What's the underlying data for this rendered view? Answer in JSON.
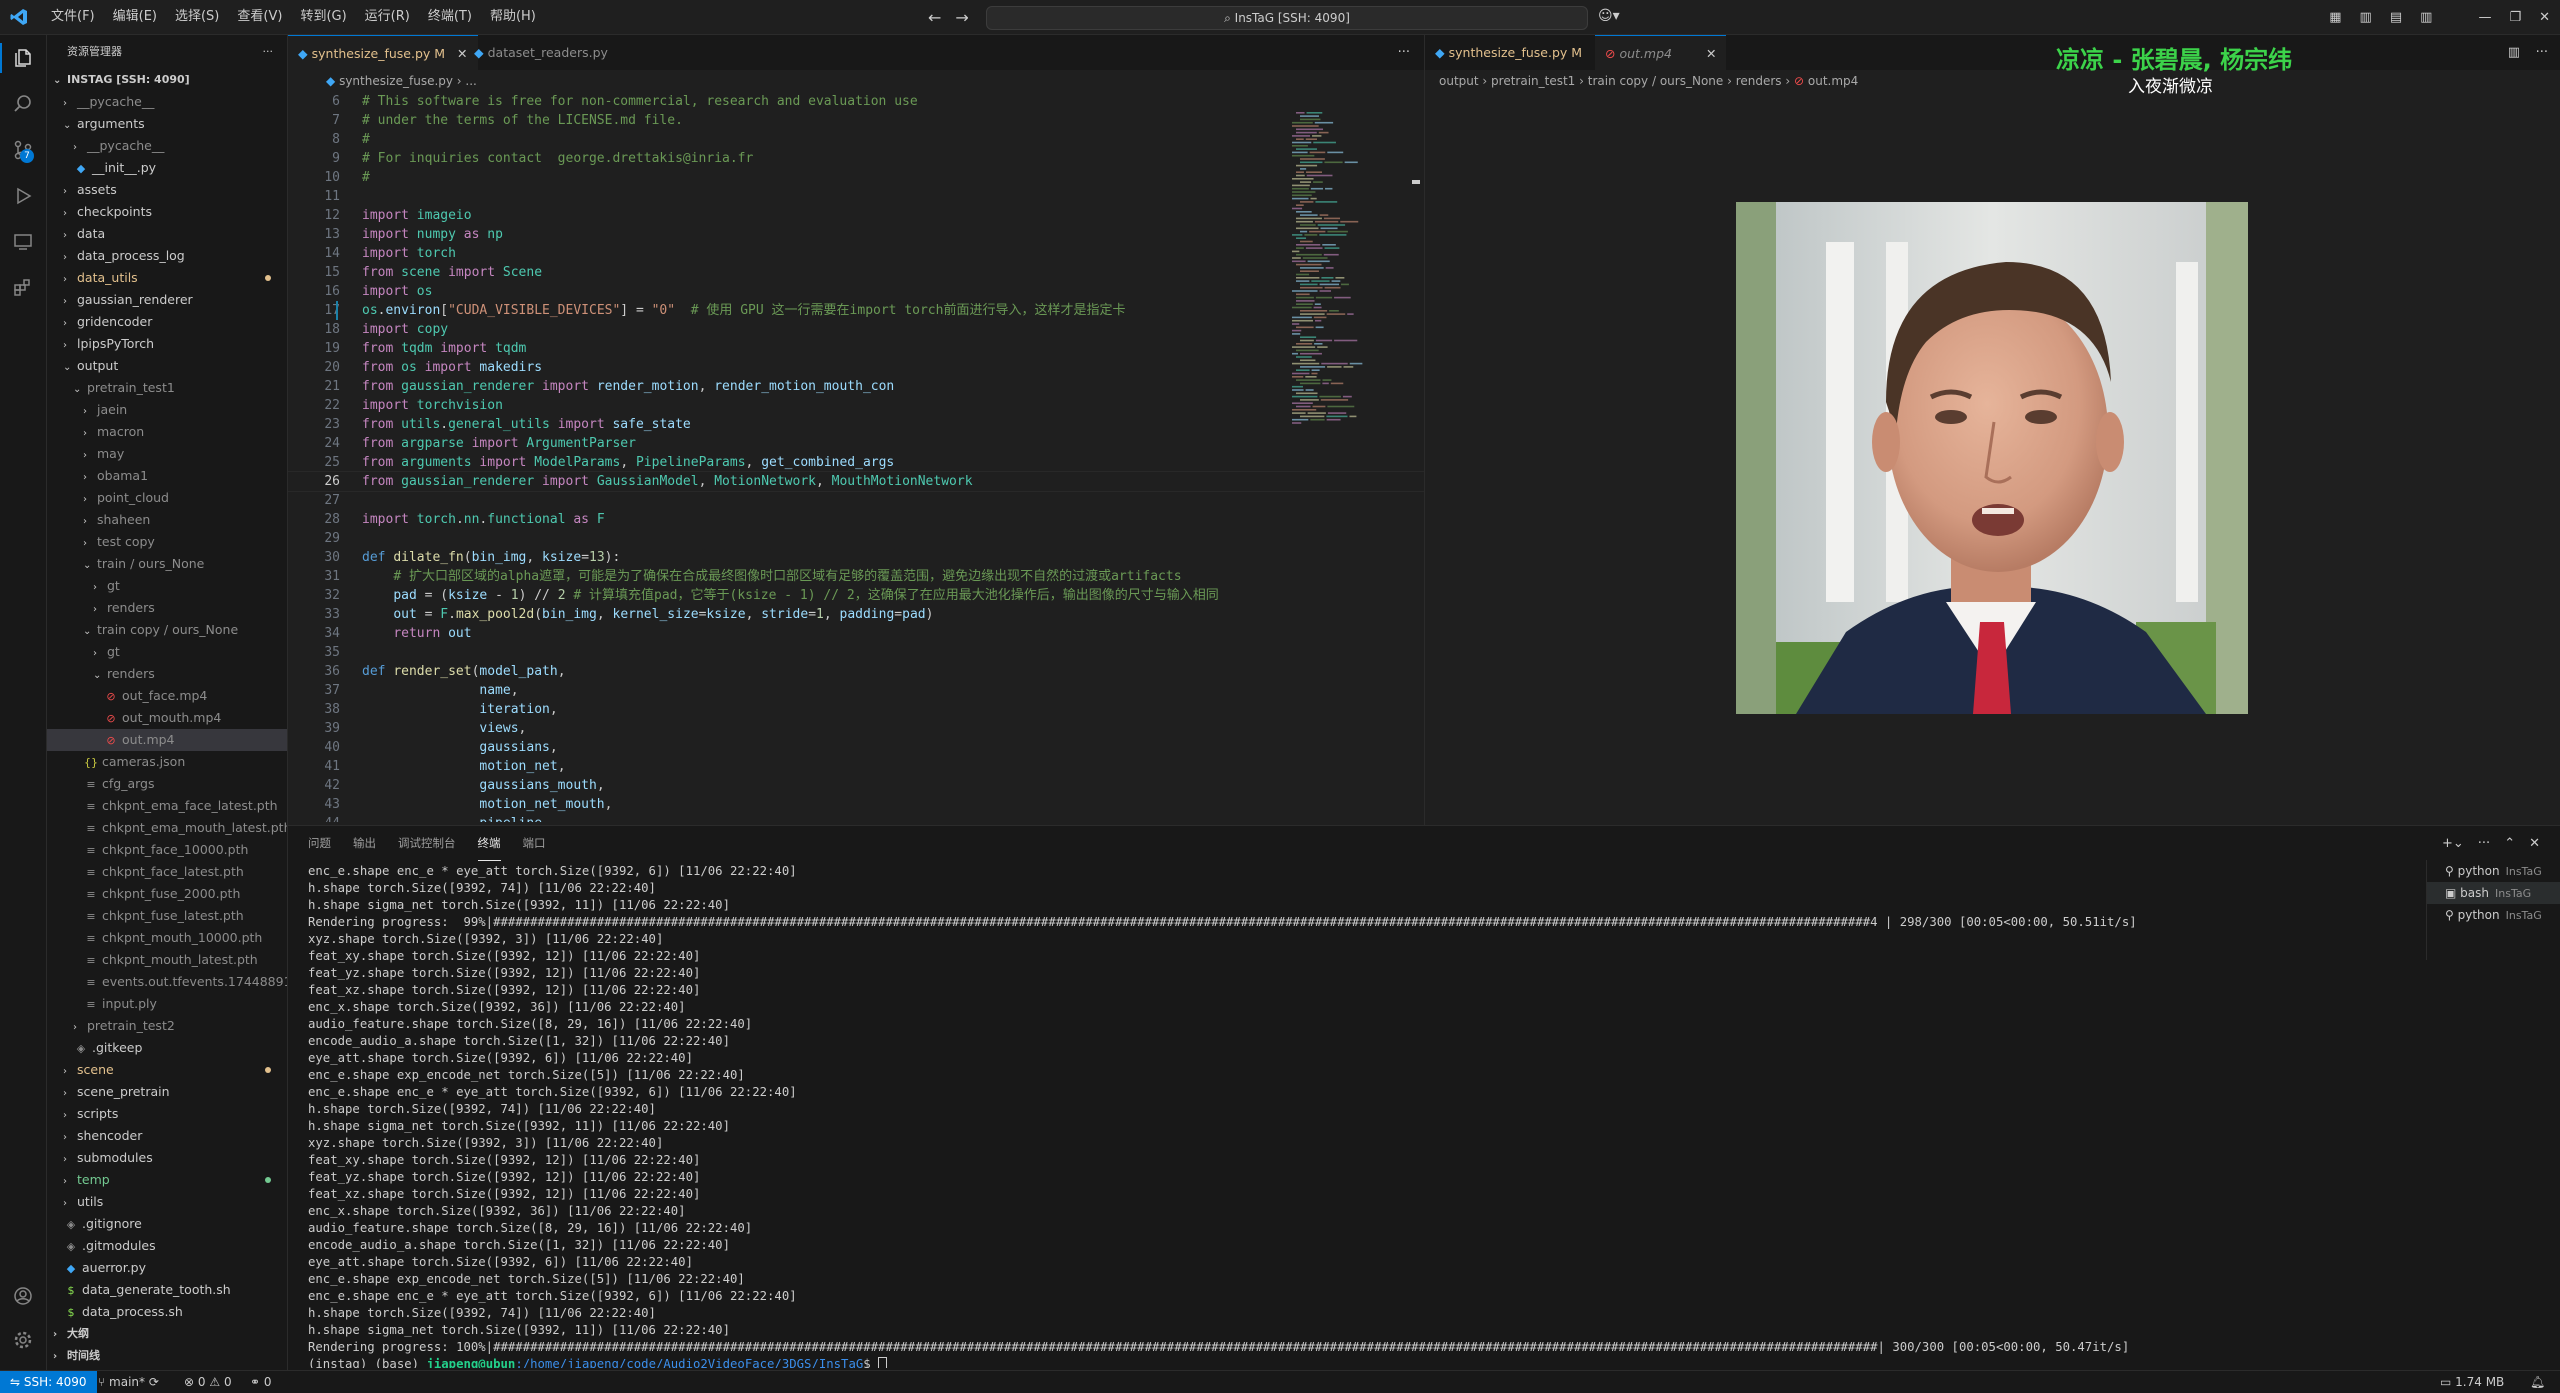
{
  "titlebar": {
    "menus": [
      "文件(F)",
      "编辑(E)",
      "选择(S)",
      "查看(V)",
      "转到(G)",
      "运行(R)",
      "终端(T)",
      "帮助(H)"
    ],
    "command_center": "InsTaG [SSH: 4090]"
  },
  "sidebar": {
    "header": "资源管理器",
    "root": "INSTAG [SSH: 4090]",
    "tree": [
      {
        "label": "__pycache__",
        "depth": 1,
        "kind": "folder",
        "color": "ignored"
      },
      {
        "label": "arguments",
        "depth": 1,
        "kind": "folder-open",
        "color": "default"
      },
      {
        "label": "__pycache__",
        "depth": 2,
        "kind": "folder",
        "color": "ignored"
      },
      {
        "label": "__init__.py",
        "depth": 2,
        "kind": "py",
        "color": "default"
      },
      {
        "label": "assets",
        "depth": 1,
        "kind": "folder",
        "color": "default"
      },
      {
        "label": "checkpoints",
        "depth": 1,
        "kind": "folder",
        "color": "default"
      },
      {
        "label": "data",
        "depth": 1,
        "kind": "folder",
        "color": "default"
      },
      {
        "label": "data_process_log",
        "depth": 1,
        "kind": "folder",
        "color": "default"
      },
      {
        "label": "data_utils",
        "depth": 1,
        "kind": "folder",
        "color": "mod",
        "dot": "#e2c08d"
      },
      {
        "label": "gaussian_renderer",
        "depth": 1,
        "kind": "folder",
        "color": "default"
      },
      {
        "label": "gridencoder",
        "depth": 1,
        "kind": "folder",
        "color": "default"
      },
      {
        "label": "lpipsPyTorch",
        "depth": 1,
        "kind": "folder",
        "color": "default"
      },
      {
        "label": "output",
        "depth": 1,
        "kind": "folder-open",
        "color": "default"
      },
      {
        "label": "pretrain_test1",
        "depth": 2,
        "kind": "folder-open",
        "color": "ignored"
      },
      {
        "label": "jaein",
        "depth": 3,
        "kind": "folder",
        "color": "ignored"
      },
      {
        "label": "macron",
        "depth": 3,
        "kind": "folder",
        "color": "ignored"
      },
      {
        "label": "may",
        "depth": 3,
        "kind": "folder",
        "color": "ignored"
      },
      {
        "label": "obama1",
        "depth": 3,
        "kind": "folder",
        "color": "ignored"
      },
      {
        "label": "point_cloud",
        "depth": 3,
        "kind": "folder",
        "color": "ignored"
      },
      {
        "label": "shaheen",
        "depth": 3,
        "kind": "folder",
        "color": "ignored"
      },
      {
        "label": "test copy",
        "depth": 3,
        "kind": "folder",
        "color": "ignored"
      },
      {
        "label": "train / ours_None",
        "depth": 3,
        "kind": "folder-open",
        "color": "ignored"
      },
      {
        "label": "gt",
        "depth": 4,
        "kind": "folder",
        "color": "ignored"
      },
      {
        "label": "renders",
        "depth": 4,
        "kind": "folder",
        "color": "ignored"
      },
      {
        "label": "train copy / ours_None",
        "depth": 3,
        "kind": "folder-open",
        "color": "ignored"
      },
      {
        "label": "gt",
        "depth": 4,
        "kind": "folder",
        "color": "ignored"
      },
      {
        "label": "renders",
        "depth": 4,
        "kind": "folder-open",
        "color": "ignored"
      },
      {
        "label": "out_face.mp4",
        "depth": 5,
        "kind": "mp4",
        "color": "ignored"
      },
      {
        "label": "out_mouth.mp4",
        "depth": 5,
        "kind": "mp4",
        "color": "ignored"
      },
      {
        "label": "out.mp4",
        "depth": 5,
        "kind": "mp4",
        "color": "ignored",
        "selected": true
      },
      {
        "label": "cameras.json",
        "depth": 3,
        "kind": "json",
        "color": "ignored"
      },
      {
        "label": "cfg_args",
        "depth": 3,
        "kind": "file",
        "color": "ignored"
      },
      {
        "label": "chkpnt_ema_face_latest.pth",
        "depth": 3,
        "kind": "file",
        "color": "ignored"
      },
      {
        "label": "chkpnt_ema_mouth_latest.pth",
        "depth": 3,
        "kind": "file",
        "color": "ignored"
      },
      {
        "label": "chkpnt_face_10000.pth",
        "depth": 3,
        "kind": "file",
        "color": "ignored"
      },
      {
        "label": "chkpnt_face_latest.pth",
        "depth": 3,
        "kind": "file",
        "color": "ignored"
      },
      {
        "label": "chkpnt_fuse_2000.pth",
        "depth": 3,
        "kind": "file",
        "color": "ignored"
      },
      {
        "label": "chkpnt_fuse_latest.pth",
        "depth": 3,
        "kind": "file",
        "color": "ignored"
      },
      {
        "label": "chkpnt_mouth_10000.pth",
        "depth": 3,
        "kind": "file",
        "color": "ignored"
      },
      {
        "label": "chkpnt_mouth_latest.pth",
        "depth": 3,
        "kind": "file",
        "color": "ignored"
      },
      {
        "label": "events.out.tfevents.174488912...",
        "depth": 3,
        "kind": "file",
        "color": "ignored"
      },
      {
        "label": "input.ply",
        "depth": 3,
        "kind": "file",
        "color": "ignored"
      },
      {
        "label": "pretrain_test2",
        "depth": 2,
        "kind": "folder",
        "color": "ignored"
      },
      {
        "label": ".gitkeep",
        "depth": 2,
        "kind": "git",
        "color": "default"
      },
      {
        "label": "scene",
        "depth": 1,
        "kind": "folder",
        "color": "mod",
        "dot": "#e2c08d"
      },
      {
        "label": "scene_pretrain",
        "depth": 1,
        "kind": "folder",
        "color": "default"
      },
      {
        "label": "scripts",
        "depth": 1,
        "kind": "folder",
        "color": "default"
      },
      {
        "label": "shencoder",
        "depth": 1,
        "kind": "folder",
        "color": "default"
      },
      {
        "label": "submodules",
        "depth": 1,
        "kind": "folder",
        "color": "default"
      },
      {
        "label": "temp",
        "depth": 1,
        "kind": "folder",
        "color": "untracked",
        "dot": "#73c991"
      },
      {
        "label": "utils",
        "depth": 1,
        "kind": "folder",
        "color": "default"
      },
      {
        "label": ".gitignore",
        "depth": 1,
        "kind": "git",
        "color": "default"
      },
      {
        "label": ".gitmodules",
        "depth": 1,
        "kind": "git",
        "color": "default"
      },
      {
        "label": "auerror.py",
        "depth": 1,
        "kind": "py",
        "color": "default"
      },
      {
        "label": "data_generate_tooth.sh",
        "depth": 1,
        "kind": "sh",
        "color": "default"
      },
      {
        "label": "data_process.sh",
        "depth": 1,
        "kind": "sh",
        "color": "default"
      }
    ],
    "sections": [
      "大纲",
      "时间线"
    ]
  },
  "editor": {
    "tabs": [
      {
        "label": "synthesize_fuse.py",
        "suffix": "M",
        "active": true
      },
      {
        "label": "dataset_readers.py",
        "suffix": "",
        "active": false
      }
    ],
    "breadcrumb": [
      "synthesize_fuse.py",
      "..."
    ],
    "current_line": 26,
    "lines": [
      {
        "n": 6,
        "t": "# This software is free for non-commercial, research and evaluation use"
      },
      {
        "n": 7,
        "t": "# under the terms of the LICENSE.md file."
      },
      {
        "n": 8,
        "t": "#"
      },
      {
        "n": 9,
        "t": "# For inquiries contact  george.drettakis@inria.fr"
      },
      {
        "n": 10,
        "t": "#"
      },
      {
        "n": 11,
        "t": ""
      },
      {
        "n": 12,
        "t": "import imageio"
      },
      {
        "n": 13,
        "t": "import numpy as np"
      },
      {
        "n": 14,
        "t": "import torch"
      },
      {
        "n": 15,
        "t": "from scene import Scene"
      },
      {
        "n": 16,
        "t": "import os"
      },
      {
        "n": 17,
        "t": "os.environ[\"CUDA_VISIBLE_DEVICES\"] = \"0\"  # 使用 GPU 这一行需要在import torch前面进行导入，这样才是指定卡"
      },
      {
        "n": 18,
        "t": "import copy"
      },
      {
        "n": 19,
        "t": "from tqdm import tqdm"
      },
      {
        "n": 20,
        "t": "from os import makedirs"
      },
      {
        "n": 21,
        "t": "from gaussian_renderer import render_motion, render_motion_mouth_con"
      },
      {
        "n": 22,
        "t": "import torchvision"
      },
      {
        "n": 23,
        "t": "from utils.general_utils import safe_state"
      },
      {
        "n": 24,
        "t": "from argparse import ArgumentParser"
      },
      {
        "n": 25,
        "t": "from arguments import ModelParams, PipelineParams, get_combined_args"
      },
      {
        "n": 26,
        "t": "from gaussian_renderer import GaussianModel, MotionNetwork, MouthMotionNetwork"
      },
      {
        "n": 27,
        "t": ""
      },
      {
        "n": 28,
        "t": "import torch.nn.functional as F"
      },
      {
        "n": 29,
        "t": ""
      },
      {
        "n": 30,
        "t": "def dilate_fn(bin_img, ksize=13):"
      },
      {
        "n": 31,
        "t": "    # 扩大口部区域的alpha遮罩，可能是为了确保在合成最终图像时口部区域有足够的覆盖范围，避免边缘出现不自然的过渡或artifacts"
      },
      {
        "n": 32,
        "t": "    pad = (ksize - 1) // 2 # 计算填充值pad，它等于(ksize - 1) // 2，这确保了在应用最大池化操作后，输出图像的尺寸与输入相同"
      },
      {
        "n": 33,
        "t": "    out = F.max_pool2d(bin_img, kernel_size=ksize, stride=1, padding=pad)"
      },
      {
        "n": 34,
        "t": "    return out"
      },
      {
        "n": 35,
        "t": ""
      },
      {
        "n": 36,
        "t": "def render_set(model_path,"
      },
      {
        "n": 37,
        "t": "               name,"
      },
      {
        "n": 38,
        "t": "               iteration,"
      },
      {
        "n": 39,
        "t": "               views,"
      },
      {
        "n": 40,
        "t": "               gaussians,"
      },
      {
        "n": 41,
        "t": "               motion_net,"
      },
      {
        "n": 42,
        "t": "               gaussians_mouth,"
      },
      {
        "n": 43,
        "t": "               motion_net_mouth,"
      },
      {
        "n": 44,
        "t": "               pipeline,"
      }
    ]
  },
  "preview": {
    "tabs": [
      {
        "label": "synthesize_fuse.py",
        "suffix": "M",
        "active": false
      },
      {
        "label": "out.mp4",
        "suffix": "",
        "active": true
      }
    ],
    "breadcrumb": [
      "output",
      "pretrain_test1",
      "train copy",
      "ours_None",
      "renders",
      "out.mp4"
    ],
    "lyrics_line1": "凉凉 - 张碧晨, 杨宗纬",
    "lyrics_line2": "入夜渐微凉"
  },
  "panel": {
    "tabs": [
      "问题",
      "输出",
      "调试控制台",
      "终端",
      "端口"
    ],
    "active_tab": "终端",
    "terminal_lines": [
      "enc_e.shape enc_e * eye_att torch.Size([9392, 6]) [11/06 22:22:40]",
      "h.shape torch.Size([9392, 74]) [11/06 22:22:40]",
      "h.shape sigma_net torch.Size([9392, 11]) [11/06 22:22:40]",
      "Rendering progress:  99%|##########################################################################################################################################################################################4 | 298/300 [00:05<00:00, 50.51it/s]",
      "xyz.shape torch.Size([9392, 3]) [11/06 22:22:40]",
      "feat_xy.shape torch.Size([9392, 12]) [11/06 22:22:40]",
      "feat_yz.shape torch.Size([9392, 12]) [11/06 22:22:40]",
      "feat_xz.shape torch.Size([9392, 12]) [11/06 22:22:40]",
      "enc_x.shape torch.Size([9392, 36]) [11/06 22:22:40]",
      "audio_feature.shape torch.Size([8, 29, 16]) [11/06 22:22:40]",
      "encode_audio_a.shape torch.Size([1, 32]) [11/06 22:22:40]",
      "eye_att.shape torch.Size([9392, 6]) [11/06 22:22:40]",
      "enc_e.shape exp_encode_net torch.Size([5]) [11/06 22:22:40]",
      "enc_e.shape enc_e * eye_att torch.Size([9392, 6]) [11/06 22:22:40]",
      "h.shape torch.Size([9392, 74]) [11/06 22:22:40]",
      "h.shape sigma_net torch.Size([9392, 11]) [11/06 22:22:40]",
      "xyz.shape torch.Size([9392, 3]) [11/06 22:22:40]",
      "feat_xy.shape torch.Size([9392, 12]) [11/06 22:22:40]",
      "feat_yz.shape torch.Size([9392, 12]) [11/06 22:22:40]",
      "feat_xz.shape torch.Size([9392, 12]) [11/06 22:22:40]",
      "enc_x.shape torch.Size([9392, 36]) [11/06 22:22:40]",
      "audio_feature.shape torch.Size([8, 29, 16]) [11/06 22:22:40]",
      "encode_audio_a.shape torch.Size([1, 32]) [11/06 22:22:40]",
      "eye_att.shape torch.Size([9392, 6]) [11/06 22:22:40]",
      "enc_e.shape exp_encode_net torch.Size([5]) [11/06 22:22:40]",
      "enc_e.shape enc_e * eye_att torch.Size([9392, 6]) [11/06 22:22:40]",
      "h.shape torch.Size([9392, 74]) [11/06 22:22:40]",
      "h.shape sigma_net torch.Size([9392, 11]) [11/06 22:22:40]",
      "Rendering progress: 100%|###########################################################################################################################################################################################| 300/300 [00:05<00:00, 50.47it/s]"
    ],
    "prompt_env": "(instag) (base) ",
    "prompt_user": "jiapeng@ubun",
    "prompt_path": ":/home/jiapeng/code/Audio2VideoFace/3DGS/InsTaG",
    "prompt_end": "$ ",
    "terminals": [
      {
        "name": "python",
        "sub": "InsTaG",
        "selected": false
      },
      {
        "name": "bash",
        "sub": "InsTaG",
        "selected": true
      },
      {
        "name": "python",
        "sub": "InsTaG",
        "selected": false
      }
    ]
  },
  "statusbar": {
    "remote": "SSH: 4090",
    "branch": "main*",
    "errors": "0",
    "warnings": "0",
    "ports": "0",
    "file_size": "1.74 MB"
  },
  "colors": {
    "accent": "#0078d4",
    "modified": "#e2c08d",
    "untracked": "#73c991",
    "lyrics": "#3cd34a"
  }
}
